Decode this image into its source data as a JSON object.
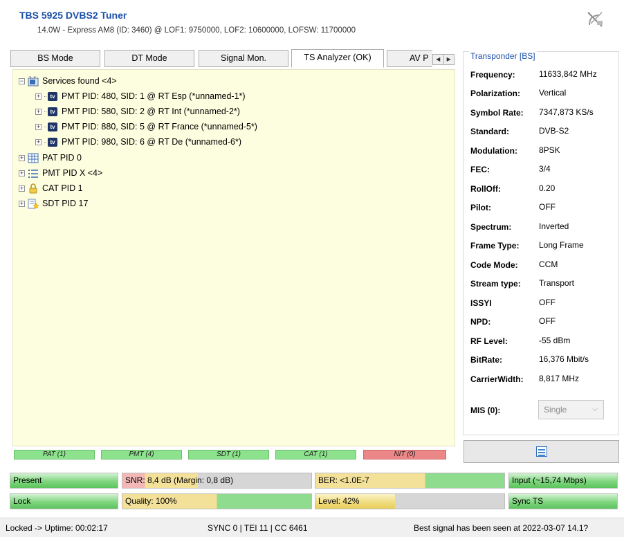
{
  "header": {
    "title": "TBS 5925 DVBS2 Tuner",
    "subtitle": "14.0W - Express AM8 (ID: 3460) @ LOF1: 9750000, LOF2: 10600000, LOFSW: 11700000",
    "icon": "satellite-icon"
  },
  "tabs": [
    {
      "label": "BS Mode"
    },
    {
      "label": "DT Mode"
    },
    {
      "label": "Signal Mon."
    },
    {
      "label": "TS Analyzer (OK)",
      "active": true
    },
    {
      "label": "AV P"
    }
  ],
  "tree": {
    "root_label": "Services found <4>",
    "services": [
      {
        "label": "PMT PID: 480, SID: 1 @ RT Esp (*unnamed-1*)"
      },
      {
        "label": "PMT PID: 580, SID: 2 @ RT Int (*unnamed-2*)"
      },
      {
        "label": "PMT PID: 880, SID: 5 @ RT France (*unnamed-5*)"
      },
      {
        "label": "PMT PID: 980, SID: 6 @ RT De (*unnamed-6*)"
      }
    ],
    "tables": [
      {
        "label": "PAT PID 0",
        "icon": "table-grid-icon"
      },
      {
        "label": "PMT PID X <4>",
        "icon": "list-icon"
      },
      {
        "label": "CAT PID 1",
        "icon": "lock-icon"
      },
      {
        "label": "SDT PID 17",
        "icon": "star-document-icon"
      }
    ]
  },
  "table_status": [
    {
      "label": "PAT (1)",
      "state": "ok"
    },
    {
      "label": "PMT (4)",
      "state": "ok"
    },
    {
      "label": "SDT (1)",
      "state": "ok"
    },
    {
      "label": "CAT (1)",
      "state": "ok"
    },
    {
      "label": "NIT (0)",
      "state": "missing"
    }
  ],
  "transponder": {
    "title": "Transponder [BS]",
    "props": [
      {
        "label": "Frequency:",
        "value": "11633,842 MHz"
      },
      {
        "label": "Polarization:",
        "value": "Vertical"
      },
      {
        "label": "Symbol Rate:",
        "value": "7347,873 KS/s"
      },
      {
        "label": "Standard:",
        "value": "DVB-S2"
      },
      {
        "label": "Modulation:",
        "value": "8PSK"
      },
      {
        "label": "FEC:",
        "value": "3/4"
      },
      {
        "label": "RollOff:",
        "value": "0.20"
      },
      {
        "label": "Pilot:",
        "value": "OFF"
      },
      {
        "label": "Spectrum:",
        "value": "Inverted"
      },
      {
        "label": "Frame Type:",
        "value": "Long Frame"
      },
      {
        "label": "Code Mode:",
        "value": "CCM"
      },
      {
        "label": "Stream type:",
        "value": "Transport"
      },
      {
        "label": "ISSYI",
        "value": "OFF"
      },
      {
        "label": "NPD:",
        "value": "OFF"
      },
      {
        "label": "RF Level:",
        "value": "-55 dBm"
      },
      {
        "label": "BitRate:",
        "value": "16,376 Mbit/s"
      },
      {
        "label": "CarrierWidth:",
        "value": "8,817 MHz"
      }
    ],
    "mis_label": "MIS (0):",
    "mis_value": "Single"
  },
  "meters": {
    "present": {
      "label": "Present",
      "fill": 1.0
    },
    "snr": {
      "label": "SNR: 8,4 dB (Margin: 0,8 dB)",
      "fill": 0.4
    },
    "ber": {
      "label": "BER: <1.0E-7",
      "fill": 1.0
    },
    "input": {
      "label": "Input (~15,74 Mbps)",
      "fill": 1.0
    },
    "lock": {
      "label": "Lock",
      "fill": 1.0
    },
    "quality": {
      "label": "Quality: 100%",
      "fill": 1.0
    },
    "level": {
      "label": "Level: 42%",
      "fill": 0.42
    },
    "sync": {
      "label": "Sync TS",
      "fill": 1.0
    }
  },
  "statusbar": {
    "uptime": "Locked -> Uptime: 00:02:17",
    "sync": "SYNC 0 | TEI 11 | CC 6461",
    "best_signal": "Best signal has been seen at 2022-03-07 14.1?"
  }
}
